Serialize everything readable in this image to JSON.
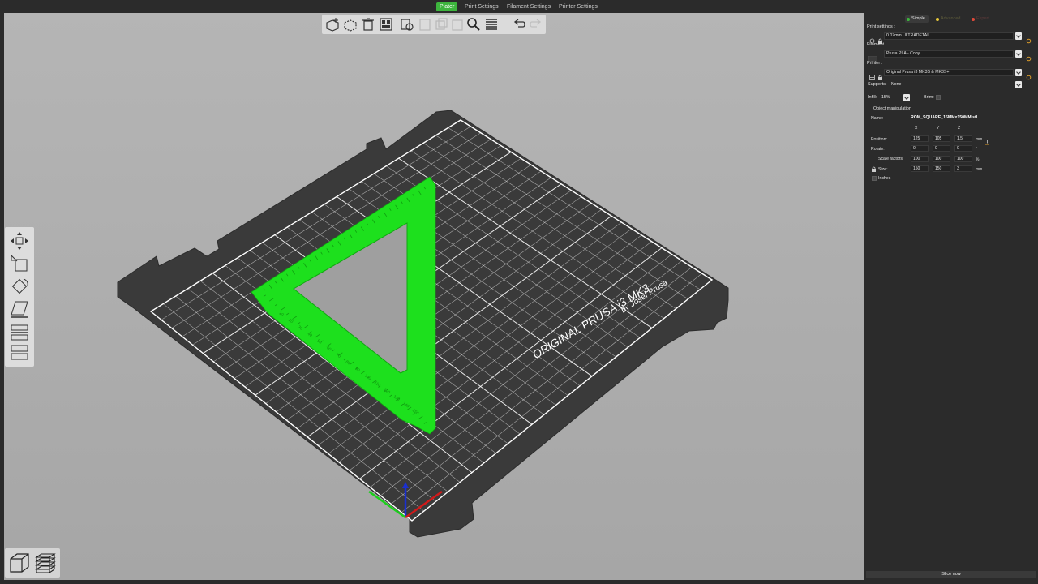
{
  "tabs": [
    {
      "label": "Plater",
      "active": true
    },
    {
      "label": "Print Settings",
      "active": false
    },
    {
      "label": "Filament Settings",
      "active": false
    },
    {
      "label": "Printer Settings",
      "active": false
    }
  ],
  "modes": {
    "simple": "Simple",
    "advanced": "Advanced",
    "expert": "Expert",
    "colors": {
      "simple": "#3db53d",
      "advanced": "#e8c93a",
      "expert": "#e04a3a"
    }
  },
  "sidebar": {
    "print_settings_label": "Print settings :",
    "print_settings_value": "0.07mm ULTRADETAIL",
    "filament_label": "Filament :",
    "filament_value": "Prusa PLA - Copy",
    "printer_label": "Printer :",
    "printer_value": "Original Prusa i3 MK3S & MK3S+",
    "supports_label": "Supports:",
    "supports_value": "None",
    "infill_label": "Infill:",
    "infill_value": "15%",
    "brim_label": "Brim:",
    "object_manipulation_label": "Object manipulation",
    "name_label": "Name:",
    "name_value": "ROM_SQUARE_15MMx150MM.stl",
    "axis_x": "X",
    "axis_y": "Y",
    "axis_z": "Z",
    "position_label": "Position:",
    "position": [
      "125",
      "105",
      "1.5"
    ],
    "position_unit": "mm",
    "rotate_label": "Rotate:",
    "rotate": [
      "0",
      "0",
      "0"
    ],
    "rotate_unit": "°",
    "scale_label": "Scale factors:",
    "scale": [
      "100",
      "100",
      "100"
    ],
    "scale_unit": "%",
    "size_label": "Size:",
    "size": [
      "150",
      "150",
      "3"
    ],
    "size_unit": "mm",
    "inches_label": "Inches",
    "slice_button": "Slice now"
  },
  "scene": {
    "bed_brand_line1": "ORIGINAL PRUSA i3 MK3",
    "bed_brand_line2": "by Josef Prusa",
    "ruler_labels": [
      "10",
      "20",
      "30",
      "40",
      "50",
      "60",
      "70",
      "80",
      "90",
      "100",
      "110",
      "120",
      "130",
      "140",
      "150"
    ],
    "colors": {
      "model": "#1de01d",
      "bed": "#3a3a3a",
      "grid": "#ffffff"
    }
  },
  "toolbar_icons": [
    "add-icon",
    "delete-icon",
    "delete-all-icon",
    "arrange-icon",
    "copy-icon",
    "paste-icon",
    "add-instance-icon",
    "remove-instance-icon",
    "split-objects-icon",
    "split-parts-icon",
    "search-icon",
    "layer-editing-icon",
    "undo-icon",
    "redo-icon"
  ],
  "left_tools": [
    "move-icon",
    "scale-icon",
    "rotate-icon",
    "place-on-face-icon",
    "cut-icon",
    "layers-icon"
  ],
  "view_buttons": [
    "3d-view-icon",
    "preview-icon"
  ]
}
